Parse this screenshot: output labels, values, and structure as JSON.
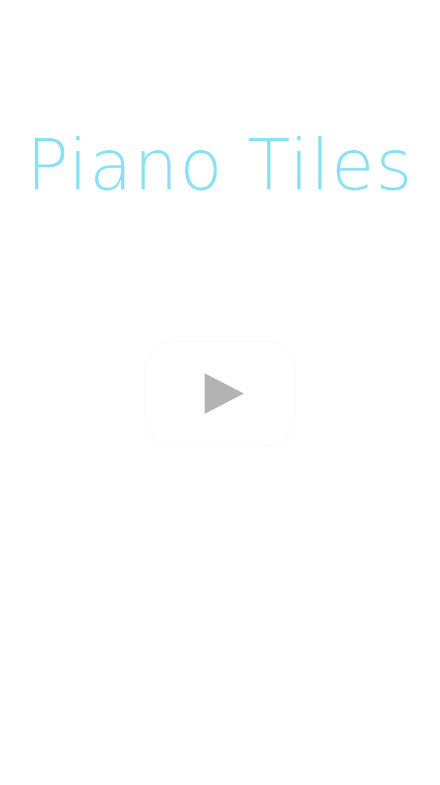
{
  "app": {
    "title": "Piano Tiles"
  },
  "play_button": {
    "icon": "play-icon",
    "icon_color": "#b3b3b3"
  },
  "colors": {
    "background": "#ffffff",
    "title": "#88e1f4"
  }
}
